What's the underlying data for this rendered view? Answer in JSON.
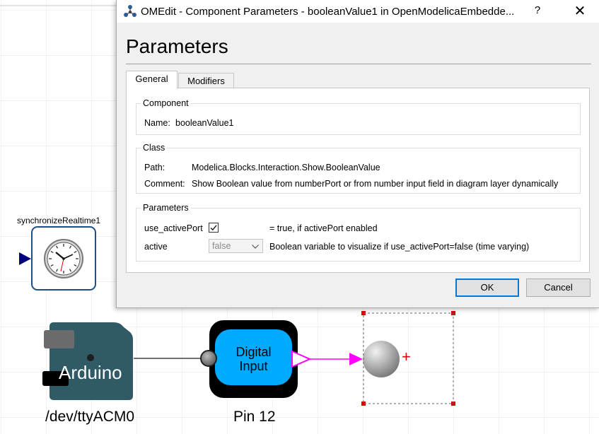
{
  "diagram": {
    "sync_label": "synchronizeRealtime1",
    "arduino_label": "Arduino",
    "arduino_port": "/dev/ttyACM0",
    "digital_input_label_line1": "Digital",
    "digital_input_label_line2": "Input",
    "digital_input_pin": "Pin 12",
    "selection_plus": "+"
  },
  "dialog": {
    "title": "OMEdit - Component Parameters - booleanValue1 in OpenModelicaEmbedde...",
    "help_button": "?",
    "close_button": "✕",
    "heading": "Parameters",
    "tabs": [
      {
        "label": "General",
        "active": true
      },
      {
        "label": "Modifiers",
        "active": false
      }
    ],
    "component": {
      "group_title": "Component",
      "name_label": "Name:",
      "name_value": "booleanValue1"
    },
    "class": {
      "group_title": "Class",
      "path_label": "Path:",
      "path_value": "Modelica.Blocks.Interaction.Show.BooleanValue",
      "comment_label": "Comment:",
      "comment_value": "Show Boolean value from numberPort or from number input field in diagram layer dynamically"
    },
    "parameters": {
      "group_title": "Parameters",
      "use_activeport_label": "use_activePort",
      "use_activeport_checked": true,
      "use_activeport_desc": "= true, if activePort enabled",
      "active_label": "active",
      "active_value": "false",
      "active_desc": "Boolean variable to visualize if use_activePort=false (time varying)"
    },
    "ok_label": "OK",
    "cancel_label": "Cancel"
  },
  "colors": {
    "digital_input_fill": "#00aaff",
    "arduino_fill": "#2f5a66",
    "connector_magenta": "#ff00ff",
    "selection_red": "#e00000",
    "ok_border": "#0078d7"
  }
}
